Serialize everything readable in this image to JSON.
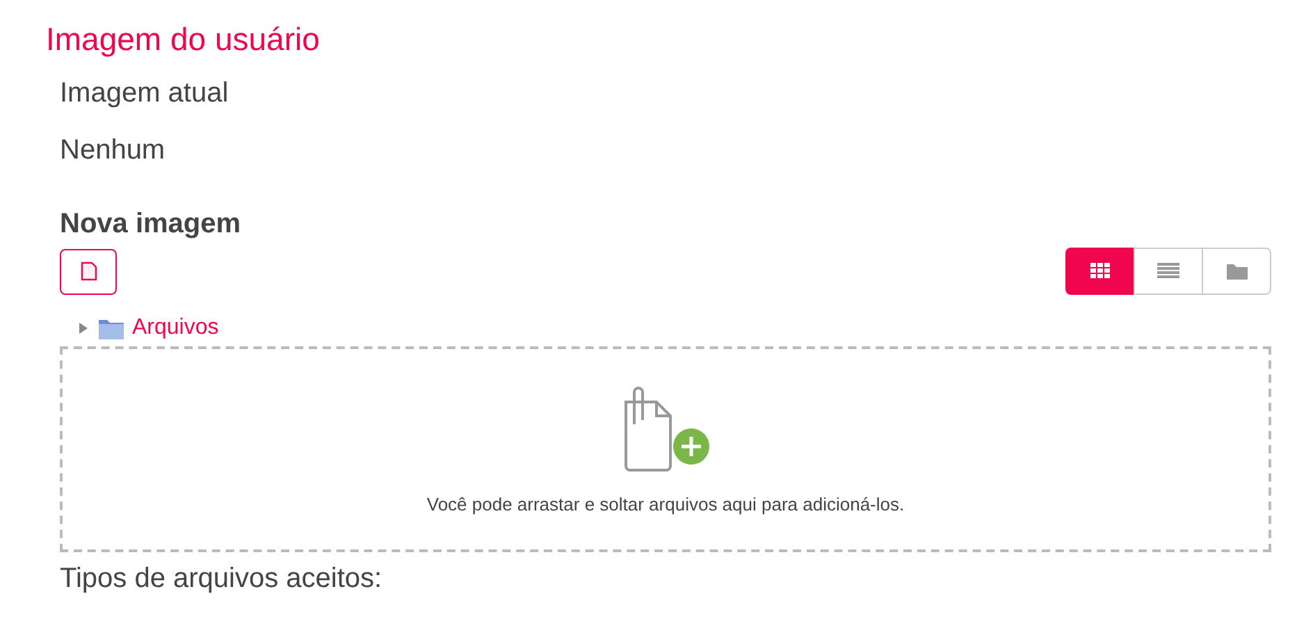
{
  "section_title": "Imagem do usuário",
  "current_image": {
    "label": "Imagem atual",
    "value": "Nenhum"
  },
  "new_image": {
    "label": "Nova imagem",
    "views": [
      {
        "kind": "grid",
        "selected": true
      },
      {
        "kind": "list",
        "selected": false
      },
      {
        "kind": "folder",
        "selected": false
      }
    ],
    "tree": {
      "label": "Arquivos",
      "expanded": false
    },
    "dropzone": {
      "text": "Você pode arrastar e soltar arquivos aqui para adicioná-los."
    }
  },
  "accepted_types": {
    "label": "Tipos de arquivos aceitos:"
  }
}
